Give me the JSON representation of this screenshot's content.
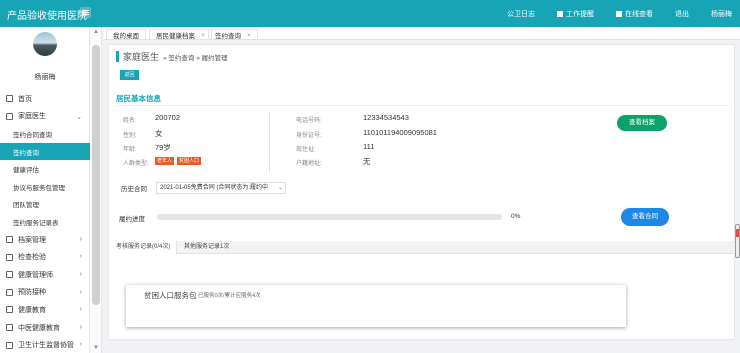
{
  "app": {
    "title": "产品验收使用医院"
  },
  "topnav": [
    {
      "label": "公卫日志",
      "icon": ""
    },
    {
      "label": "工作提醒",
      "icon": "square-icon"
    },
    {
      "label": "在线查看",
      "icon": "square-icon"
    },
    {
      "label": "退出",
      "icon": ""
    },
    {
      "label": "杨丽梅",
      "icon": ""
    }
  ],
  "user": {
    "name": "杨丽梅"
  },
  "sidebar": {
    "items": [
      {
        "label": "首页",
        "level": 0,
        "icon": "home-icon"
      },
      {
        "label": "家庭医生",
        "level": 0,
        "icon": "doctor-icon",
        "expanded": true
      },
      {
        "label": "签约合同查询",
        "level": 1
      },
      {
        "label": "签约查询",
        "level": 1,
        "active": true
      },
      {
        "label": "健康评估",
        "level": 1
      },
      {
        "label": "协议与服务包管理",
        "level": 1
      },
      {
        "label": "团队管理",
        "level": 1
      },
      {
        "label": "签约服务记录表",
        "level": 1
      },
      {
        "label": "档案管理",
        "level": 0,
        "icon": "archive-icon"
      },
      {
        "label": "检查检验",
        "level": 0,
        "icon": "test-icon"
      },
      {
        "label": "健康管理师",
        "level": 0,
        "icon": "manage-icon"
      },
      {
        "label": "预防接种",
        "level": 0,
        "icon": "vaccine-icon"
      },
      {
        "label": "健康教育",
        "level": 0,
        "icon": "education-icon"
      },
      {
        "label": "中医健康教育",
        "level": 0,
        "icon": "tcm-icon"
      },
      {
        "label": "卫生计生监督协管",
        "level": 0,
        "icon": "supervise-icon"
      }
    ]
  },
  "tabs": [
    {
      "label": "我的桌面"
    },
    {
      "label": "居民健康档案",
      "closable": true
    },
    {
      "label": "签约查询",
      "closable": true,
      "active": true
    }
  ],
  "breadcrumb": {
    "main": "家庭医生",
    "rest": "» 签约查询 » 履约管理"
  },
  "back_button": "返回",
  "section": {
    "title": "居民基本信息"
  },
  "resident": {
    "name_label": "姓名:",
    "name": "200702",
    "gender_label": "性别:",
    "gender": "女",
    "age_label": "年龄:",
    "age": "79岁",
    "type_label": "人群类型:",
    "tags": [
      "老年人",
      "贫困人口"
    ],
    "phone_label": "电话号码:",
    "phone": "12334534543",
    "id_label": "身份证号:",
    "id": "110101194009095081",
    "address_label": "现住址:",
    "address": "111",
    "hukou_label": "户籍地址:",
    "hukou": "无"
  },
  "view_record_button": "查看档案",
  "history": {
    "label": "历史合同",
    "value": "2021-01-05免费合同 (合同状态为:履约中"
  },
  "progress": {
    "label": "履约进度",
    "percent": 0,
    "text": "0%"
  },
  "view_contract_button": "查看合同",
  "record_tabs": [
    {
      "label": "考核服务记录(0/4次)",
      "active": true
    },
    {
      "label": "其他服务记录1次"
    }
  ],
  "service": {
    "name": "贫困人口服务包",
    "count": "已服务0次/累计应服务4次"
  }
}
